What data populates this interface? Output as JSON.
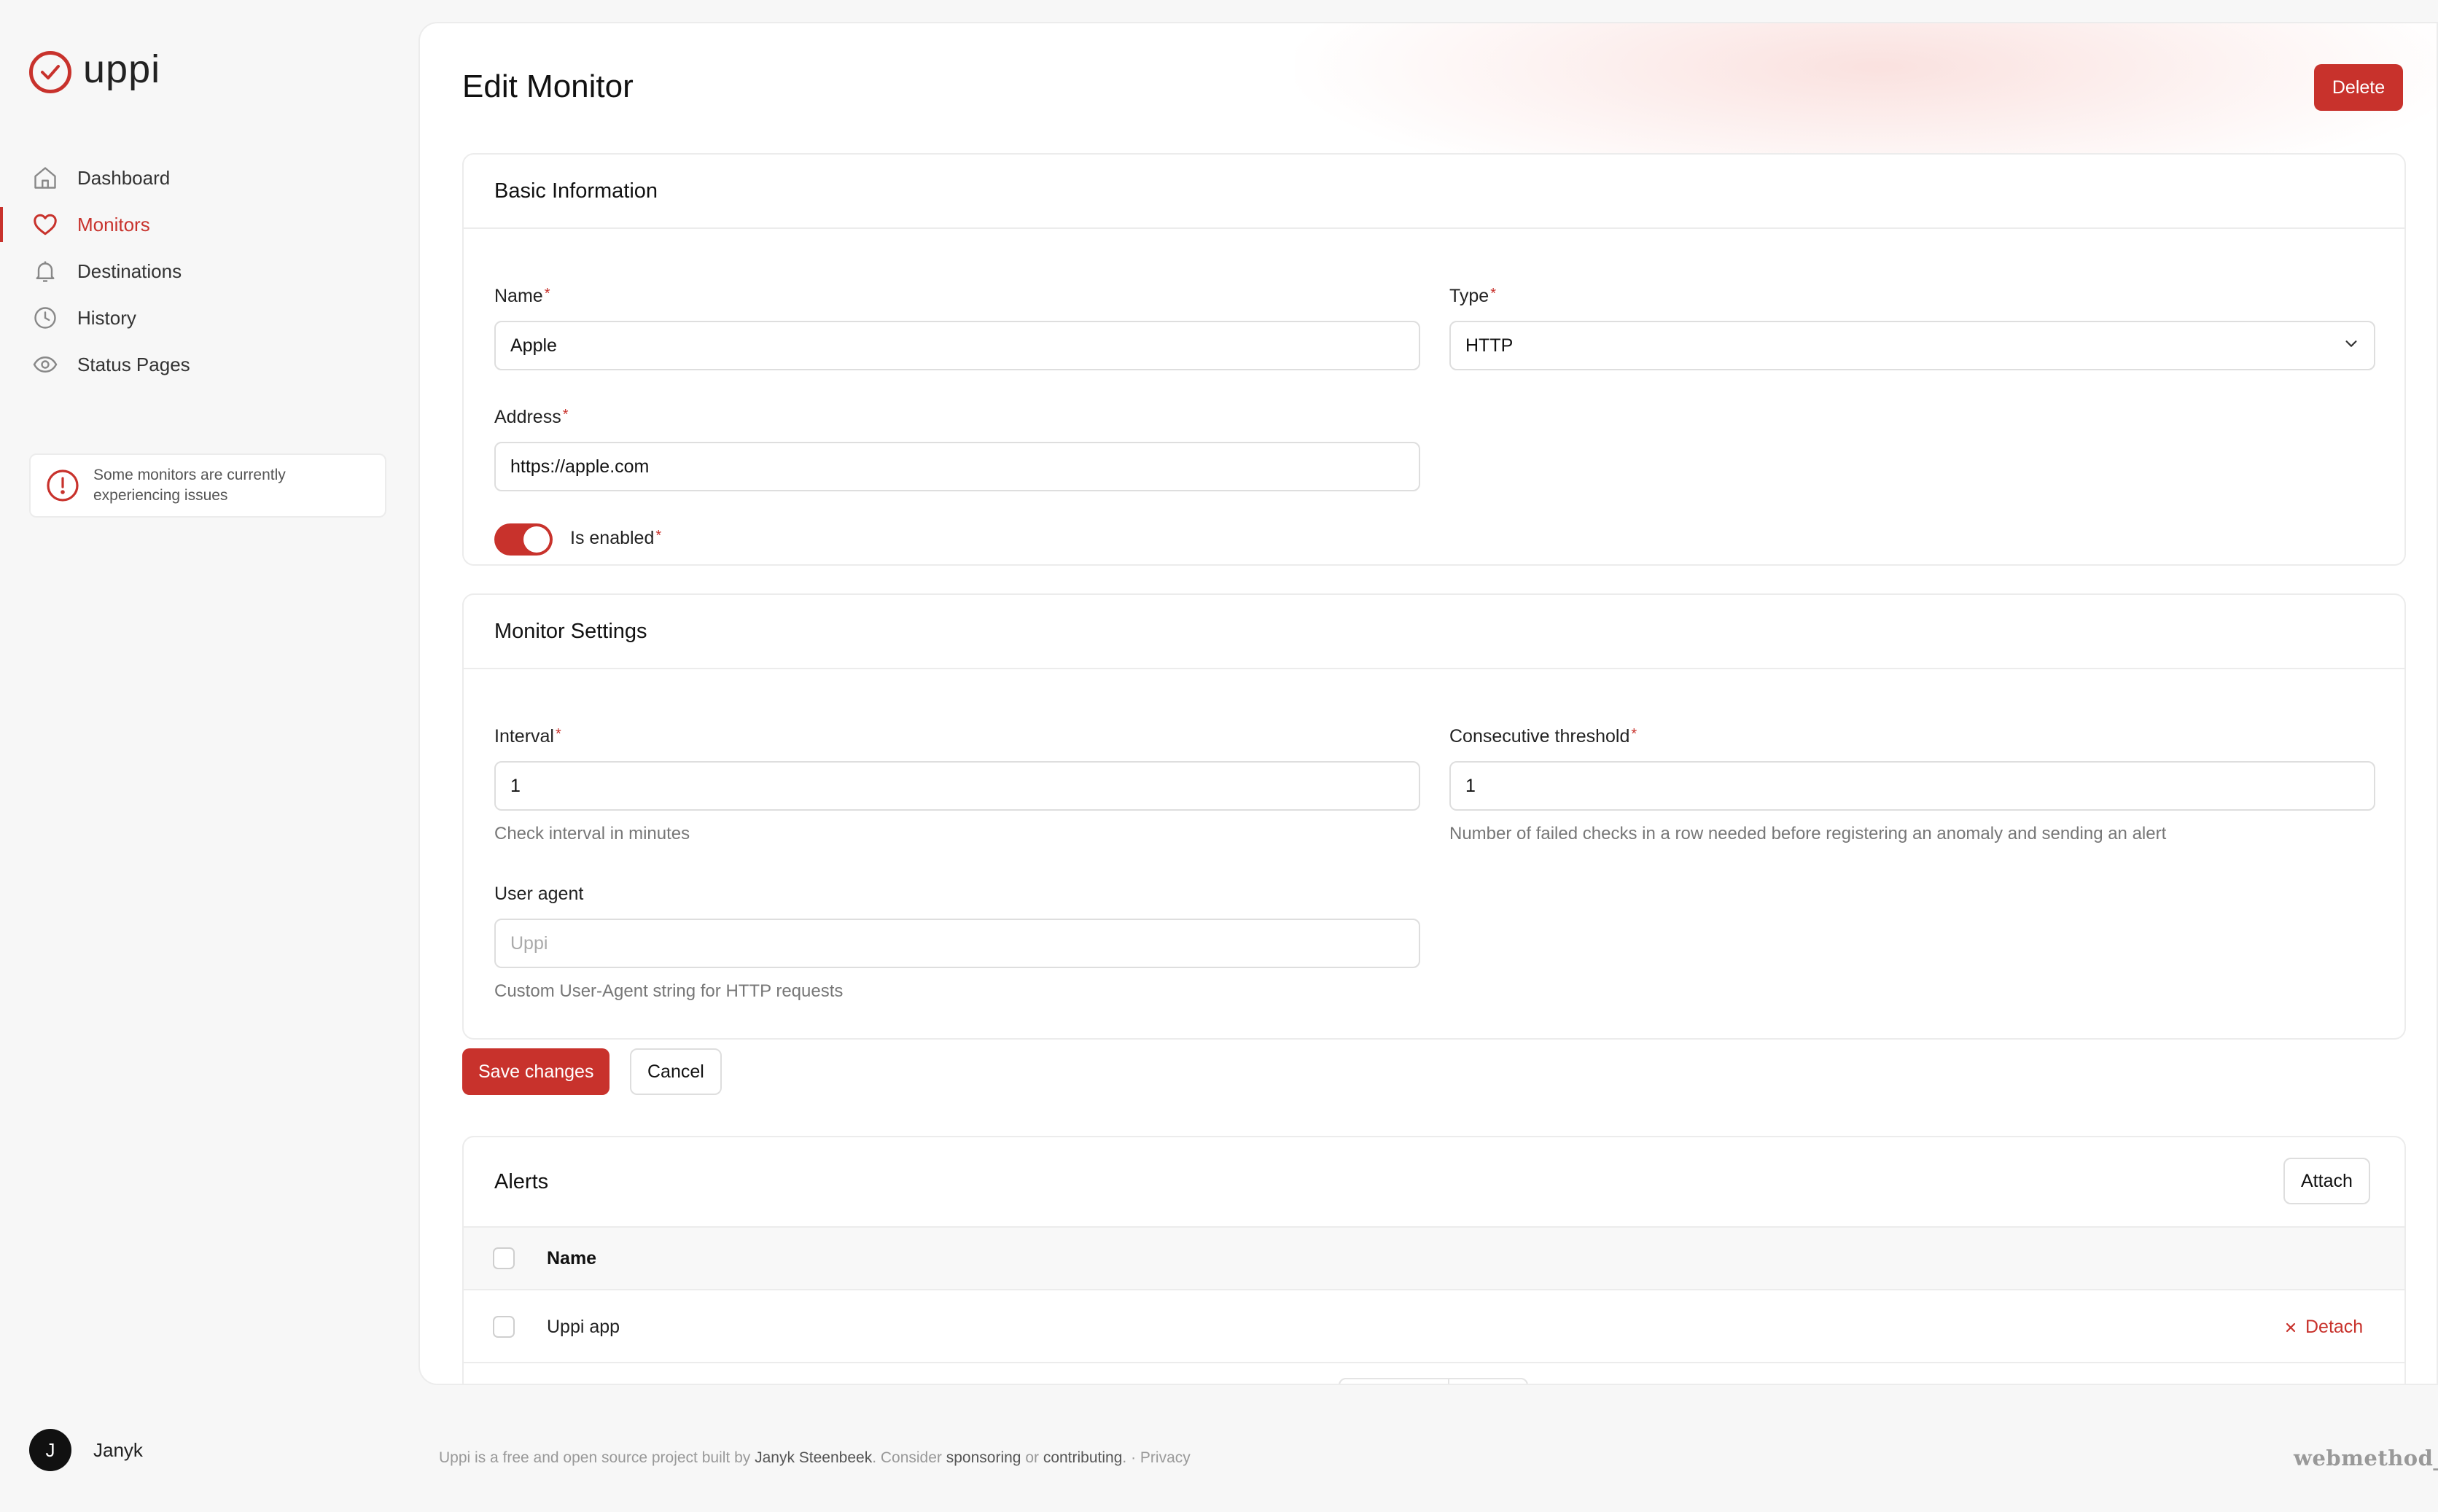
{
  "app": {
    "name": "uppi"
  },
  "sidebar": {
    "items": [
      {
        "label": "Dashboard",
        "icon": "home-icon",
        "active": false
      },
      {
        "label": "Monitors",
        "icon": "heart-icon",
        "active": true
      },
      {
        "label": "Destinations",
        "icon": "bell-icon",
        "active": false
      },
      {
        "label": "History",
        "icon": "clock-icon",
        "active": false
      },
      {
        "label": "Status Pages",
        "icon": "eye-icon",
        "active": false
      }
    ],
    "alert": {
      "text": "Some monitors are currently experiencing issues",
      "icon": "alert-circle-icon"
    },
    "user": {
      "initial": "J",
      "name": "Janyk"
    }
  },
  "page": {
    "title": "Edit Monitor",
    "delete_label": "Delete"
  },
  "basic": {
    "title": "Basic Information",
    "name_label": "Name",
    "name_value": "Apple",
    "type_label": "Type",
    "type_value": "HTTP",
    "address_label": "Address",
    "address_value": "https://apple.com",
    "enabled_label": "Is enabled",
    "enabled": true,
    "required_mark": "*"
  },
  "settings": {
    "title": "Monitor Settings",
    "interval_label": "Interval",
    "interval_value": "1",
    "interval_hint": "Check interval in minutes",
    "threshold_label": "Consecutive threshold",
    "threshold_value": "1",
    "threshold_hint": "Number of failed checks in a row needed before registering an anomaly and sending an alert",
    "useragent_label": "User agent",
    "useragent_placeholder": "Uppi",
    "useragent_hint": "Custom User-Agent string for HTTP requests"
  },
  "actions": {
    "save_label": "Save changes",
    "cancel_label": "Cancel"
  },
  "alerts": {
    "title": "Alerts",
    "attach_label": "Attach",
    "columns": [
      "Name"
    ],
    "rows": [
      {
        "name": "Uppi app",
        "action": "Detach"
      }
    ]
  },
  "footer": {
    "prefix": "Uppi is a free and open source project built by ",
    "author": "Janyk Steenbeek",
    "mid": ". Consider ",
    "sponsoring": "sponsoring",
    "or": " or ",
    "contributing": "contributing",
    "sep": ". · ",
    "privacy": "Privacy",
    "brand": "webmethod_"
  },
  "colors": {
    "accent": "#c8322c",
    "background": "#f7f7f7",
    "border": "#ececec"
  }
}
